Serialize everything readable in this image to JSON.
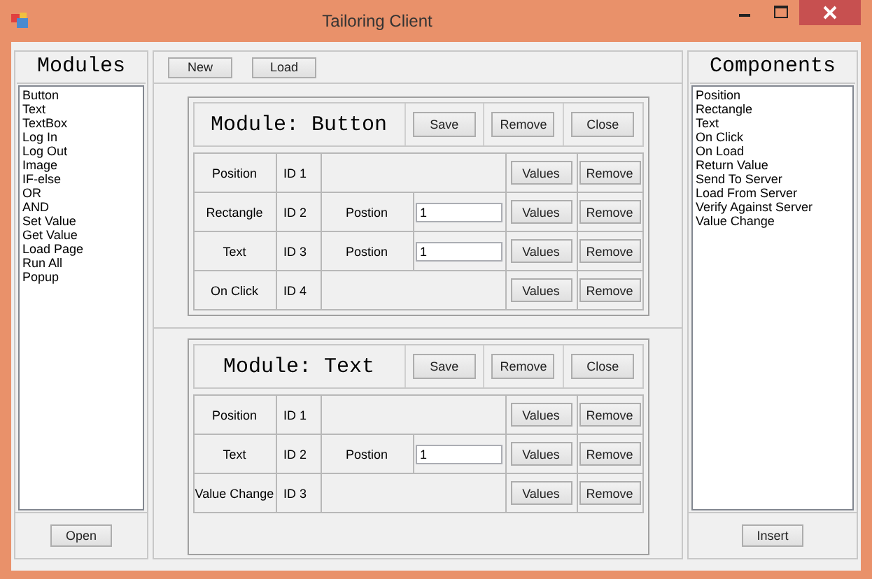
{
  "window": {
    "title": "Tailoring Client"
  },
  "modules_panel": {
    "title": "Modules",
    "items": [
      "Button",
      "Text",
      "TextBox",
      "Log In",
      "Log Out",
      "Image",
      "IF-else",
      "OR",
      "AND",
      "Set Value",
      "Get Value",
      "Load Page",
      "Run All",
      "Popup"
    ],
    "button": "Open"
  },
  "toolbar": {
    "buttons": [
      "New",
      "Load"
    ]
  },
  "modules": [
    {
      "title": "Module: Button",
      "buttons": [
        "Save",
        "Remove",
        "Close"
      ],
      "rows": [
        {
          "name": "Position",
          "id": "ID 1",
          "values_button": "Values",
          "remove_button": "Remove"
        },
        {
          "name": "Rectangle",
          "id": "ID 2",
          "field_label": "Postion",
          "field_value": "1",
          "values_button": "Values",
          "remove_button": "Remove"
        },
        {
          "name": "Text",
          "id": "ID 3",
          "field_label": "Postion",
          "field_value": "1",
          "values_button": "Values",
          "remove_button": "Remove"
        },
        {
          "name": "On Click",
          "id": "ID 4",
          "values_button": "Values",
          "remove_button": "Remove"
        }
      ]
    },
    {
      "title": "Module: Text",
      "buttons": [
        "Save",
        "Remove",
        "Close"
      ],
      "rows": [
        {
          "name": "Position",
          "id": "ID 1",
          "values_button": "Values",
          "remove_button": "Remove"
        },
        {
          "name": "Text",
          "id": "ID 2",
          "field_label": "Postion",
          "field_value": "1",
          "values_button": "Values",
          "remove_button": "Remove"
        },
        {
          "name": "Value Change",
          "id": "ID 3",
          "values_button": "Values",
          "remove_button": "Remove"
        }
      ]
    }
  ],
  "components_panel": {
    "title": "Components",
    "items": [
      "Position",
      "Rectangle",
      "Text",
      "On Click",
      "On Load",
      "Return Value",
      "Send To Server",
      "Load From Server",
      "Verify Against Server",
      "Value Change"
    ],
    "button": "Insert"
  }
}
